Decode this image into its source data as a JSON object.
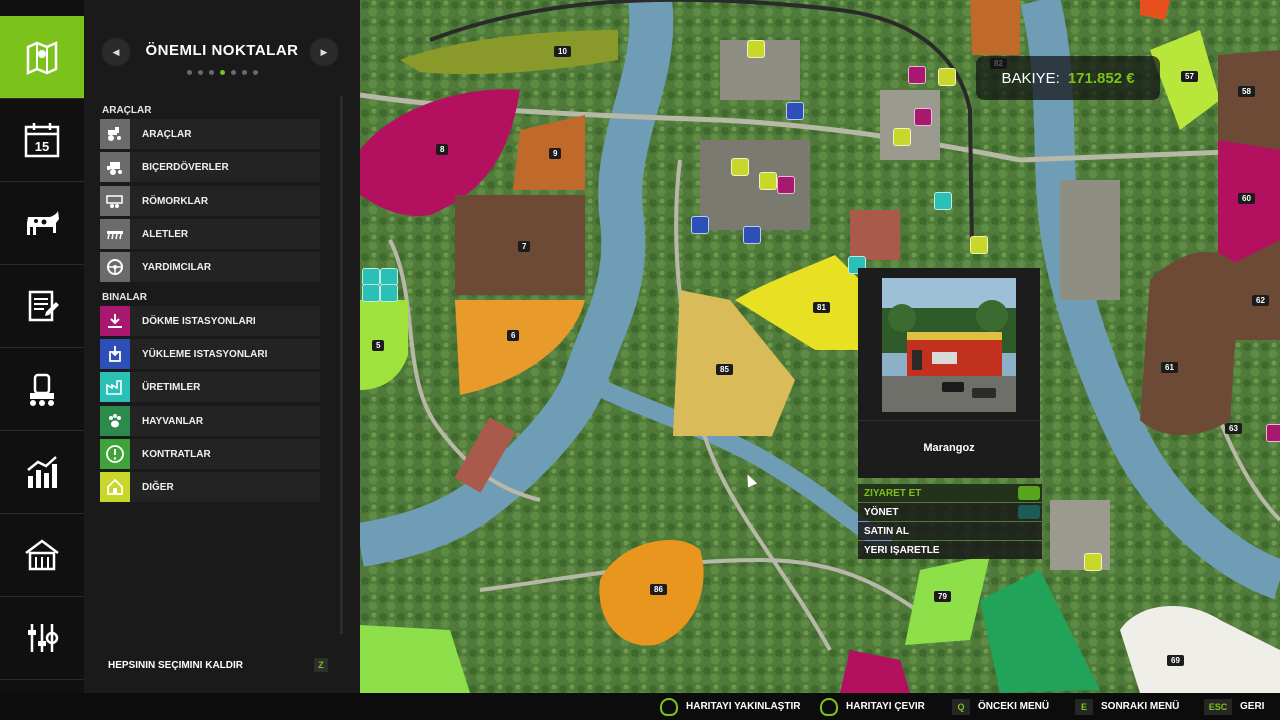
{
  "panel": {
    "title": "ÖNEMLI NOKTALAR",
    "prev_symbol": "◀",
    "next_symbol": "▶",
    "page_count": 7,
    "active_page": 4,
    "vehicles_section": "ARAÇLAR",
    "vehicles": [
      {
        "label": "ARAÇLAR",
        "icon": "tractor-icon"
      },
      {
        "label": "BIÇERDÖVERLER",
        "icon": "harvester-icon"
      },
      {
        "label": "RÖMORKLAR",
        "icon": "trailer-icon"
      },
      {
        "label": "ALETLER",
        "icon": "tool-icon"
      },
      {
        "label": "YARDIMCILAR",
        "icon": "steering-wheel-icon"
      }
    ],
    "buildings_section": "BINALAR",
    "buildings": [
      {
        "label": "DÖKME ISTASYONLARI",
        "icon": "unload-icon",
        "color": "#a8186e"
      },
      {
        "label": "YÜKLEME ISTASYONLARI",
        "icon": "load-icon",
        "color": "#2c4fb8"
      },
      {
        "label": "ÜRETIMLER",
        "icon": "factory-icon",
        "color": "#2bc0b5"
      },
      {
        "label": "HAYVANLAR",
        "icon": "paw-icon",
        "color": "#2b8a4c"
      },
      {
        "label": "KONTRATLAR",
        "icon": "exclamation-icon",
        "color": "#3fa33a"
      },
      {
        "label": "DIĞER",
        "icon": "house-icon",
        "color": "#c9d62a"
      }
    ],
    "deselect_label": "HEPSININ SEÇIMINI KALDIR",
    "deselect_key": "Z"
  },
  "rail": [
    {
      "icon": "map-icon",
      "active": true
    },
    {
      "icon": "calendar-icon",
      "text": "15"
    },
    {
      "icon": "cow-icon"
    },
    {
      "icon": "contracts-icon"
    },
    {
      "icon": "production-icon"
    },
    {
      "icon": "stats-icon"
    },
    {
      "icon": "garage-icon"
    },
    {
      "icon": "settings-icon"
    }
  ],
  "balance": {
    "label": "BAKIYE:",
    "value": "171.852 €"
  },
  "popup": {
    "name": "Marangoz",
    "actions": [
      {
        "label": "ZIYARET ET",
        "selected": true
      },
      {
        "label": "YÖNET"
      },
      {
        "label": "SATIN AL"
      },
      {
        "label": "YERI IŞARETLE"
      }
    ]
  },
  "fields": [
    "10",
    "8",
    "9",
    "7",
    "6",
    "5",
    "85",
    "81",
    "86",
    "79",
    "57",
    "58",
    "60",
    "62",
    "61",
    "63",
    "69",
    "82"
  ],
  "bottom_hints": [
    {
      "icon": "mouse-wheel-icon",
      "label": "HARITAYI YAKINLAŞTIR"
    },
    {
      "icon": "mouse-drag-icon",
      "label": "HARITAYI ÇEVIR"
    },
    {
      "key": "Q",
      "label": "ÖNCEKI MENÜ"
    },
    {
      "key": "E",
      "label": "SONRAKI MENÜ"
    },
    {
      "key": "ESC",
      "label": "GERI"
    }
  ],
  "colors": {
    "accent": "#7bc31a",
    "river": "#6f9db6",
    "road": "#b8b8a8"
  }
}
